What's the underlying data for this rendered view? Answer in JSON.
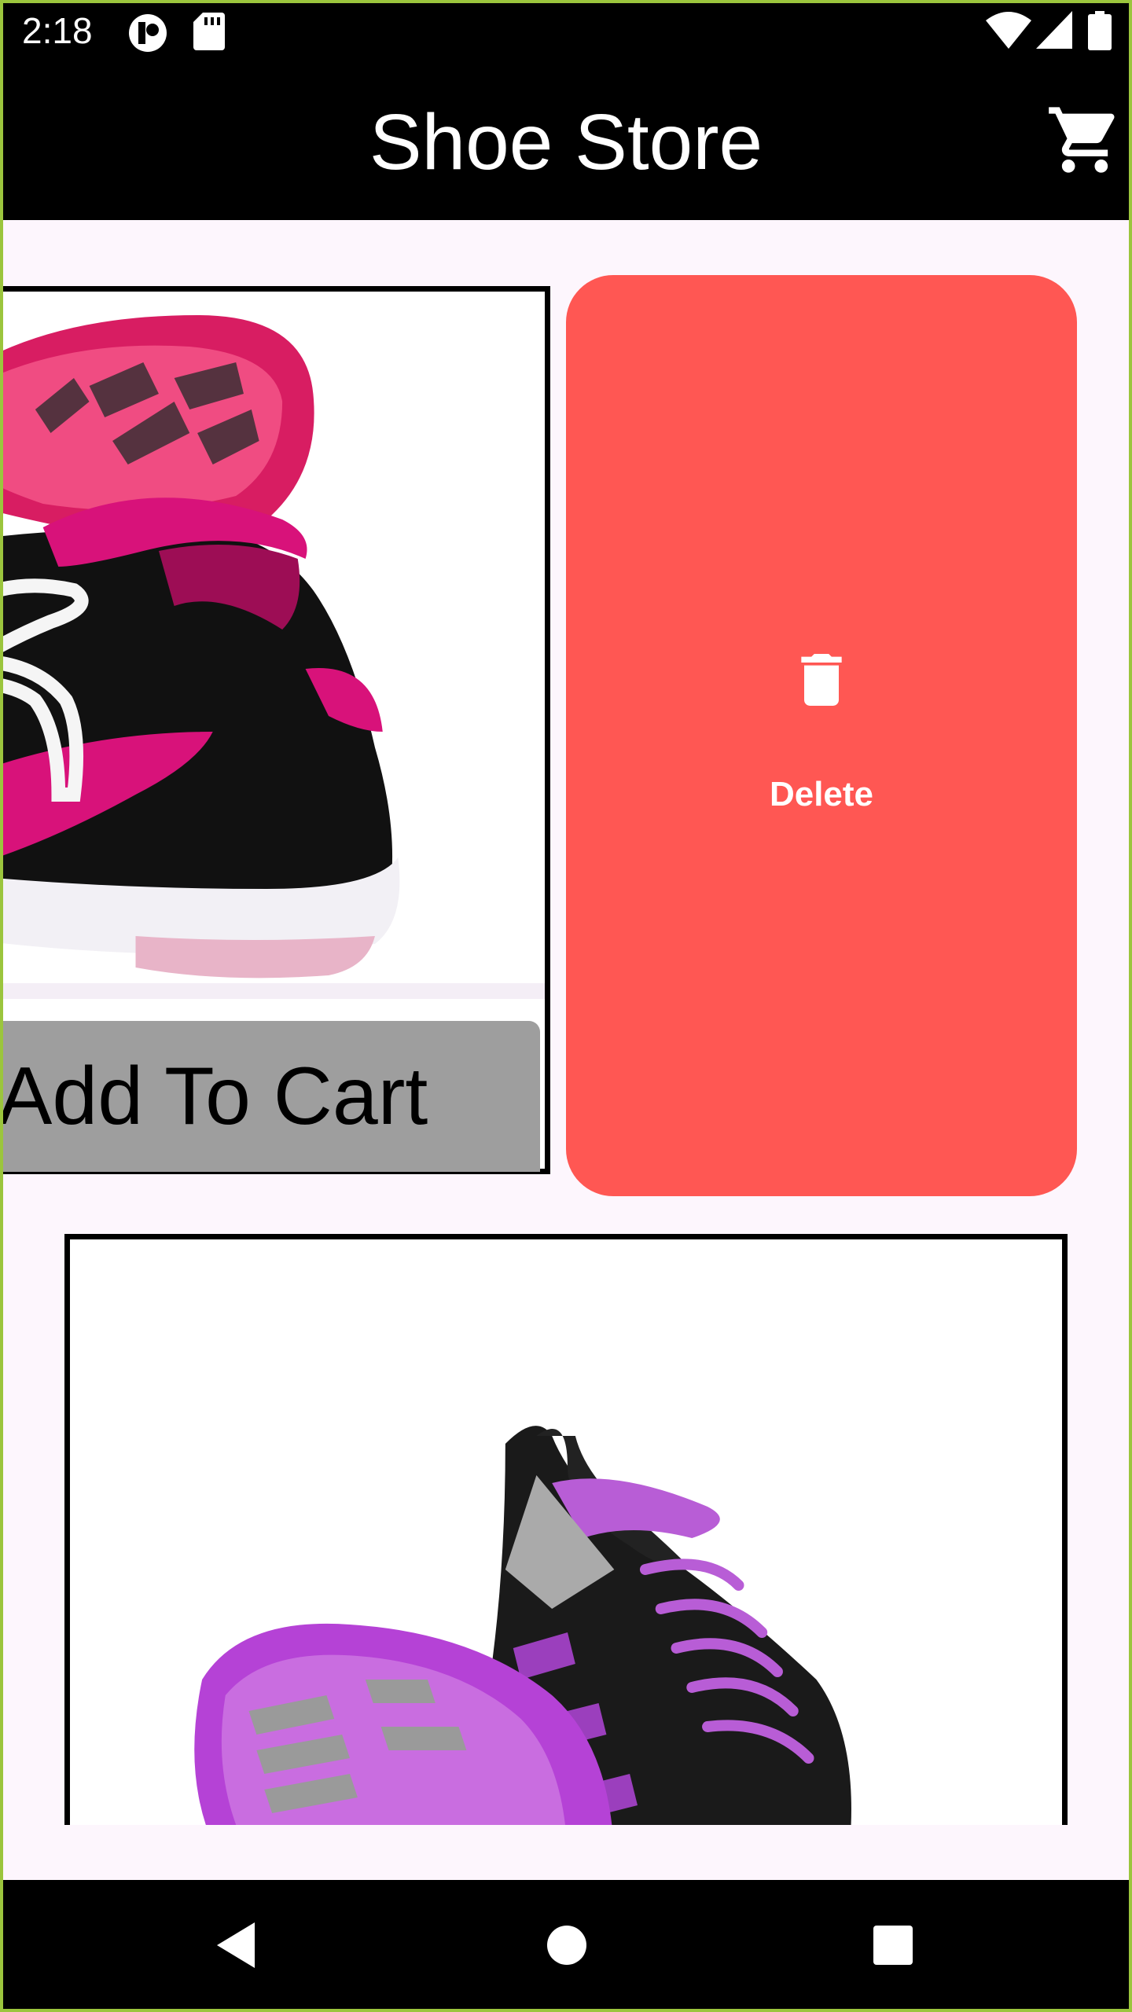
{
  "status_bar": {
    "time": "2:18",
    "icons": [
      "notification-icon",
      "sd-card-icon",
      "wifi-icon",
      "signal-icon",
      "battery-icon"
    ]
  },
  "app_bar": {
    "title": "Shoe Store",
    "cart_icon": "shopping-cart-icon"
  },
  "products": [
    {
      "add_to_cart_label": "Add To Cart",
      "image": "pink-black-sneaker",
      "swipe_action": {
        "label": "Delete",
        "icon": "trash-icon",
        "color": "#ff5753"
      }
    },
    {
      "image": "purple-black-running-shoe"
    }
  ],
  "navigation": {
    "buttons": [
      "back-icon",
      "home-icon",
      "recents-icon"
    ]
  },
  "colors": {
    "app_bar": "#000000",
    "background": "#fdf6fd",
    "delete": "#ff5753",
    "add_to_cart": "#9e9e9e"
  }
}
